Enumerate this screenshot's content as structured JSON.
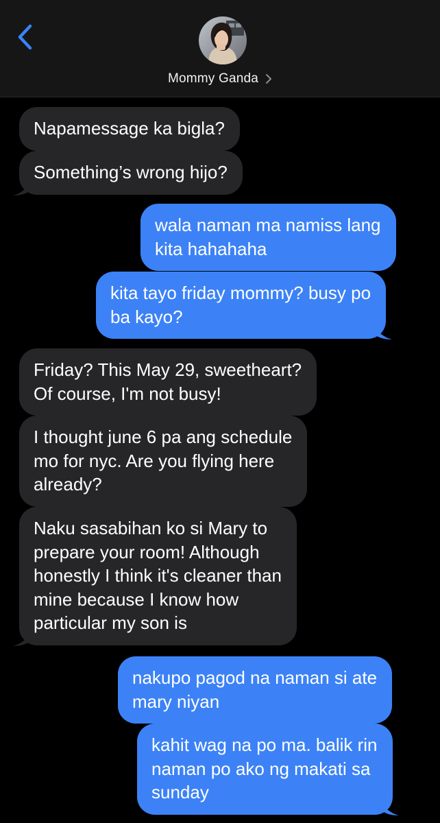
{
  "header": {
    "back_icon": "chevron-left-icon",
    "contact_name": "Mommy Ganda",
    "contact_chevron_icon": "chevron-right-icon",
    "avatar_icon": "contact-photo"
  },
  "colors": {
    "incoming_bubble": "#262628",
    "outgoing_bubble": "#3c82f6",
    "accent": "#3a84f7",
    "background": "#000000"
  },
  "messages": [
    {
      "from": "contact",
      "lines": [
        "Napamessage ka bigla?"
      ]
    },
    {
      "from": "contact",
      "lines": [
        "Something’s wrong hijo?"
      ]
    },
    {
      "from": "me",
      "lines": [
        "wala naman ma namiss lang",
        "kita hahahaha"
      ]
    },
    {
      "from": "me",
      "lines": [
        "kita tayo friday mommy? busy po",
        "ba kayo?"
      ]
    },
    {
      "from": "contact",
      "lines": [
        "Friday? This May 29, sweetheart?",
        "Of course, I'm not busy!"
      ]
    },
    {
      "from": "contact",
      "lines": [
        "I thought june 6 pa ang schedule",
        "mo for nyc. Are you flying here",
        "already?"
      ]
    },
    {
      "from": "contact",
      "lines": [
        "Naku sasabihan ko si Mary to",
        "prepare your room! Although",
        "honestly I think it's cleaner than",
        "mine because I know how",
        "particular my son is"
      ]
    },
    {
      "from": "me",
      "lines": [
        "nakupo pagod na naman si ate",
        "mary niyan"
      ]
    },
    {
      "from": "me",
      "lines": [
        "kahit wag na po ma. balik rin",
        "naman po ako ng makati sa",
        "sunday"
      ]
    }
  ]
}
